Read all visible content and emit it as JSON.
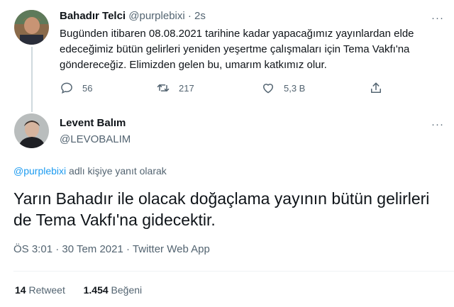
{
  "tweet1": {
    "name": "Bahadır Telci",
    "handle": "@purplebixi",
    "separator": "·",
    "time": "2s",
    "more": "···",
    "text": "Bugünden itibaren 08.08.2021 tarihine kadar yapacağımız yayınlardan elde edeceğimiz bütün gelirleri yeniden yeşertme çalışmaları için Tema Vakfı'na göndereceğiz. Elimizden gelen bu, umarım katkımız olur.",
    "replies": "56",
    "retweets": "217",
    "likes": "5,3 B"
  },
  "tweet2": {
    "name": "Levent Balım",
    "handle": "@LEVOBALIM",
    "more": "···",
    "reply_mention": "@purplebixi",
    "reply_suffix": " adlı kişiye yanıt olarak",
    "text": "Yarın Bahadır ile olacak doğaçlama yayının bütün gelirleri de Tema Vakfı'na gidecektir.",
    "meta": "ÖS 3:01 · 30 Tem 2021 · Twitter Web App",
    "retweet_count": "14",
    "retweet_label": "Retweet",
    "like_count": "1.454",
    "like_label": "Beğeni"
  },
  "colors": {
    "text": "#0f1419",
    "secondary": "#536471",
    "accent": "#1d9bf0",
    "line": "#cfd9de"
  },
  "icons": [
    "reply-icon",
    "retweet-icon",
    "like-icon",
    "share-icon",
    "more-icon"
  ]
}
